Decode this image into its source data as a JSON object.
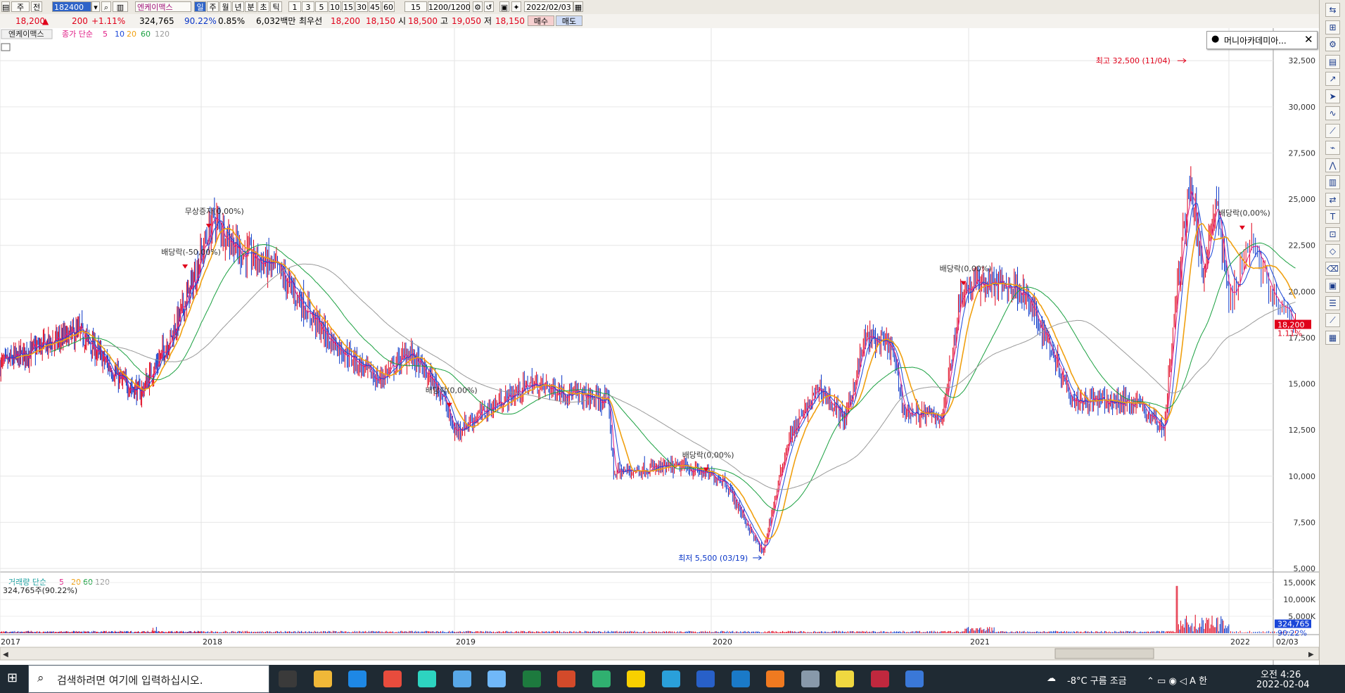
{
  "toolbar": {
    "market": "주",
    "mode": "전",
    "code": "182400",
    "name": "엔케이맥스",
    "periods": [
      "일",
      "주",
      "월",
      "년",
      "분",
      "초",
      "틱"
    ],
    "active_period": "일",
    "intervals": [
      "1",
      "3",
      "5",
      "10",
      "15",
      "30",
      "45",
      "60"
    ],
    "interval_value": "15",
    "count": "1200/1200",
    "date": "2022/02/03"
  },
  "quote": {
    "price": "18,200",
    "change": "200",
    "change_pct": "+1.11%",
    "volume": "324,765",
    "vol_ratio": "90.22%",
    "turnover_rate": "0.85%",
    "amount": "6,032백만",
    "best_label": "최우선",
    "ask": "18,200",
    "bid": "18,150",
    "open_label": "시",
    "open": "18,500",
    "high_label": "고",
    "high": "19,050",
    "low_label": "저",
    "low": "18,150",
    "buy_label": "매수",
    "sell_label": "매도"
  },
  "legend": {
    "stock_name": "엔케이맥스",
    "price_label": "종가 단순",
    "ma": [
      "5",
      "10",
      "20",
      "60",
      "120"
    ],
    "volume_label": "거래량 단순",
    "vol_ma": [
      "5",
      "20",
      "60",
      "120"
    ],
    "volume_text": "324,765주(90.22%)"
  },
  "popup": {
    "text": "머니아카데미아..."
  },
  "colors": {
    "up": "#e0001a",
    "down": "#0a36c8",
    "ma5": "#e01d86",
    "ma10": "#1a46d8",
    "ma20": "#f0a010",
    "ma60": "#1aa040",
    "ma120": "#9a9a9a"
  },
  "chart_data": [
    {
      "type": "candlestick",
      "title": "",
      "x": [
        "2017",
        "2018",
        "2019",
        "2020",
        "2021",
        "2022",
        "02/03"
      ],
      "ylim": [
        5000,
        33500
      ],
      "yticks": [
        "5,000",
        "7,500",
        "10,000",
        "12,500",
        "15,000",
        "17,500",
        "20,000",
        "22,500",
        "25,000",
        "27,500",
        "30,000",
        "32,500"
      ],
      "grid": true,
      "current": {
        "label": "18,200",
        "pct": "1.11%"
      },
      "price_path": [
        [
          2017.0,
          16000
        ],
        [
          2017.2,
          17000
        ],
        [
          2017.4,
          17800
        ],
        [
          2017.6,
          15200
        ],
        [
          2017.7,
          14500
        ],
        [
          2017.85,
          17500
        ],
        [
          2017.97,
          20800
        ],
        [
          2018.05,
          24000
        ],
        [
          2018.15,
          22200
        ],
        [
          2018.3,
          21200
        ],
        [
          2018.5,
          17500
        ],
        [
          2018.7,
          15200
        ],
        [
          2018.82,
          16700
        ],
        [
          2018.95,
          14500
        ],
        [
          2019.0,
          12400
        ],
        [
          2019.15,
          13800
        ],
        [
          2019.3,
          15000
        ],
        [
          2019.45,
          14500
        ],
        [
          2019.6,
          14000
        ],
        [
          2019.62,
          10200
        ],
        [
          2019.75,
          10400
        ],
        [
          2019.9,
          10500
        ],
        [
          2020.05,
          9800
        ],
        [
          2020.2,
          5800
        ],
        [
          2020.3,
          12000
        ],
        [
          2020.42,
          14800
        ],
        [
          2020.52,
          13000
        ],
        [
          2020.6,
          17500
        ],
        [
          2020.7,
          17000
        ],
        [
          2020.75,
          13500
        ],
        [
          2020.9,
          13200
        ],
        [
          2020.97,
          20000
        ],
        [
          2021.05,
          20500
        ],
        [
          2021.2,
          20200
        ],
        [
          2021.3,
          17500
        ],
        [
          2021.4,
          14200
        ],
        [
          2021.55,
          14000
        ],
        [
          2021.65,
          14000
        ],
        [
          2021.75,
          12500
        ],
        [
          2021.8,
          20000
        ],
        [
          2021.85,
          26000
        ],
        [
          2021.9,
          21000
        ],
        [
          2021.95,
          25000
        ],
        [
          2022.0,
          19500
        ],
        [
          2022.05,
          23000
        ],
        [
          2022.1,
          19500
        ],
        [
          2022.15,
          18200
        ]
      ],
      "annotations": [
        {
          "text": "무상증자(0,00%)",
          "x": 2018.03,
          "y": 24200
        },
        {
          "text": "배당락(-50,00%)",
          "x": 2017.92,
          "y": 22000
        },
        {
          "text": "배당락(0,00%)",
          "x": 2018.98,
          "y": 14500
        },
        {
          "text": "배당락(0,00%)",
          "x": 2019.98,
          "y": 11000
        },
        {
          "text": "배당락(0,00%)",
          "x": 2020.98,
          "y": 21100
        },
        {
          "text": "배당락(0,00%)",
          "x": 2022.03,
          "y": 24100
        }
      ],
      "high_marker": {
        "text": "최고 32,500 (11/04)",
        "x": 2021.84,
        "y": 32500
      },
      "low_marker": {
        "text": "최저 5,500 (03/19)",
        "x": 2020.2,
        "y": 5500
      }
    },
    {
      "type": "bar",
      "title": "",
      "ylim": [
        0,
        15000
      ],
      "yticks": [
        "5,000K",
        "10,000K",
        "15,000K"
      ],
      "current": {
        "label": "324,765",
        "pct": "90.22%"
      }
    }
  ],
  "taskbar": {
    "search_placeholder": "검색하려면 여기에 입력하십시오.",
    "weather": "-8°C 구름 조금",
    "time": "오전 4:26",
    "date": "2022-02-04"
  }
}
